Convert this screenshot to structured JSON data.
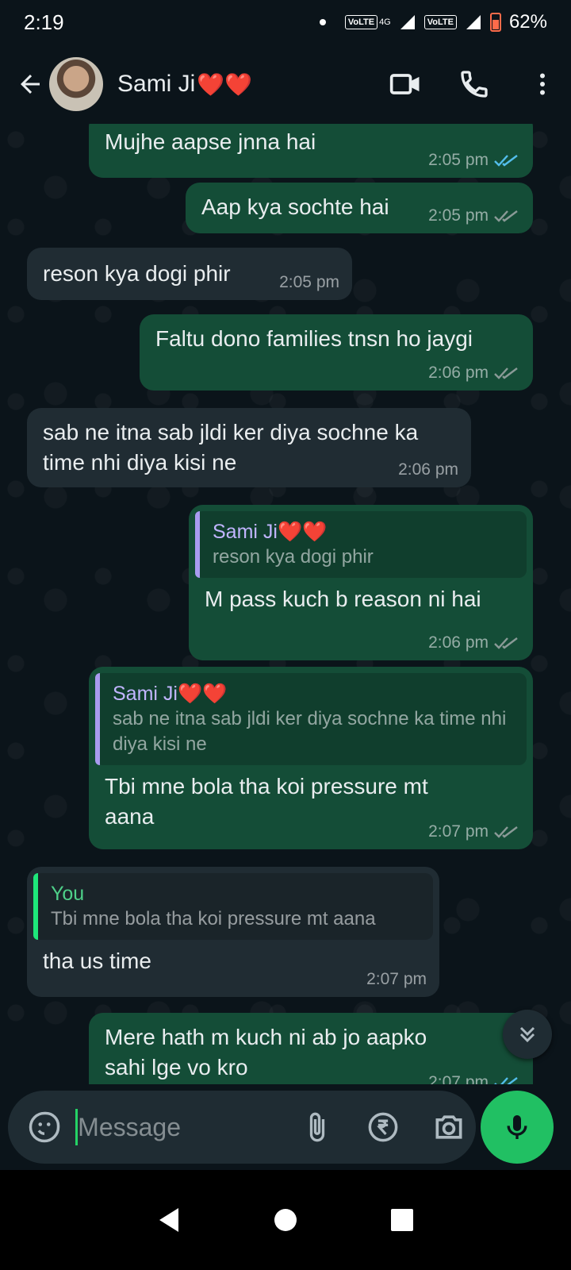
{
  "status_bar": {
    "time": "2:19",
    "volte1": "VoLTE",
    "network": "4G",
    "volte2": "VoLTE",
    "battery": "62%"
  },
  "header": {
    "contact_name": "Sami Ji",
    "name_hearts": "❤️❤️"
  },
  "messages": [
    {
      "direction": "out",
      "text": "Mujhe aapse jnna hai",
      "time": "2:05 pm",
      "status": "read"
    },
    {
      "direction": "out",
      "text": "Aap kya sochte hai",
      "time": "2:05 pm",
      "status": "delivered"
    },
    {
      "direction": "in",
      "text": "reson kya dogi phir",
      "time": "2:05 pm"
    },
    {
      "direction": "out",
      "text": "Faltu dono families tnsn ho jaygi",
      "time": "2:06 pm",
      "status": "delivered"
    },
    {
      "direction": "in",
      "text": "sab ne itna sab jldi ker diya sochne ka time nhi diya kisi ne",
      "time": "2:06 pm"
    },
    {
      "direction": "out",
      "quote_author": "Sami Ji❤️❤️",
      "quote_text": "reson kya dogi phir",
      "text": "M pass kuch b reason ni hai",
      "time": "2:06 pm",
      "status": "delivered"
    },
    {
      "direction": "out",
      "quote_author": "Sami Ji❤️❤️",
      "quote_text": "sab ne itna sab jldi ker diya sochne ka time nhi diya kisi ne",
      "text": "Tbi mne bola tha koi pressure mt aana",
      "time": "2:07 pm",
      "status": "delivered"
    },
    {
      "direction": "in",
      "quote_author": "You",
      "quote_text": "Tbi mne bola tha koi pressure mt aana",
      "text": "tha us time",
      "time": "2:07 pm"
    },
    {
      "direction": "out",
      "text": "Mere hath m kuch ni ab jo aapko sahi lge vo kro",
      "time": "2:07 pm",
      "status": "read"
    }
  ],
  "composer": {
    "placeholder": "Message"
  },
  "colors": {
    "accent": "#21c063",
    "outgoing_bubble": "#144d37",
    "incoming_bubble": "#202c33",
    "read_tick": "#53bdeb"
  }
}
